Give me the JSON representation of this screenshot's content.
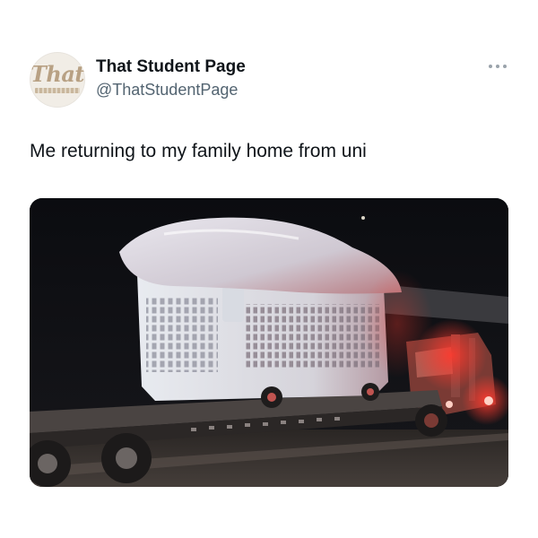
{
  "tweet": {
    "author": {
      "display_name": "That Student Page",
      "handle": "@ThatStudentPage",
      "avatar_logo_text": "That"
    },
    "text": "Me returning to my family home from uni",
    "media": {
      "kind": "photo",
      "icon": "photo-icon"
    },
    "more_icon": "more-horizontal-icon"
  },
  "colors": {
    "name_text": "#0f1419",
    "handle_text": "#536471",
    "background": "#ffffff"
  }
}
